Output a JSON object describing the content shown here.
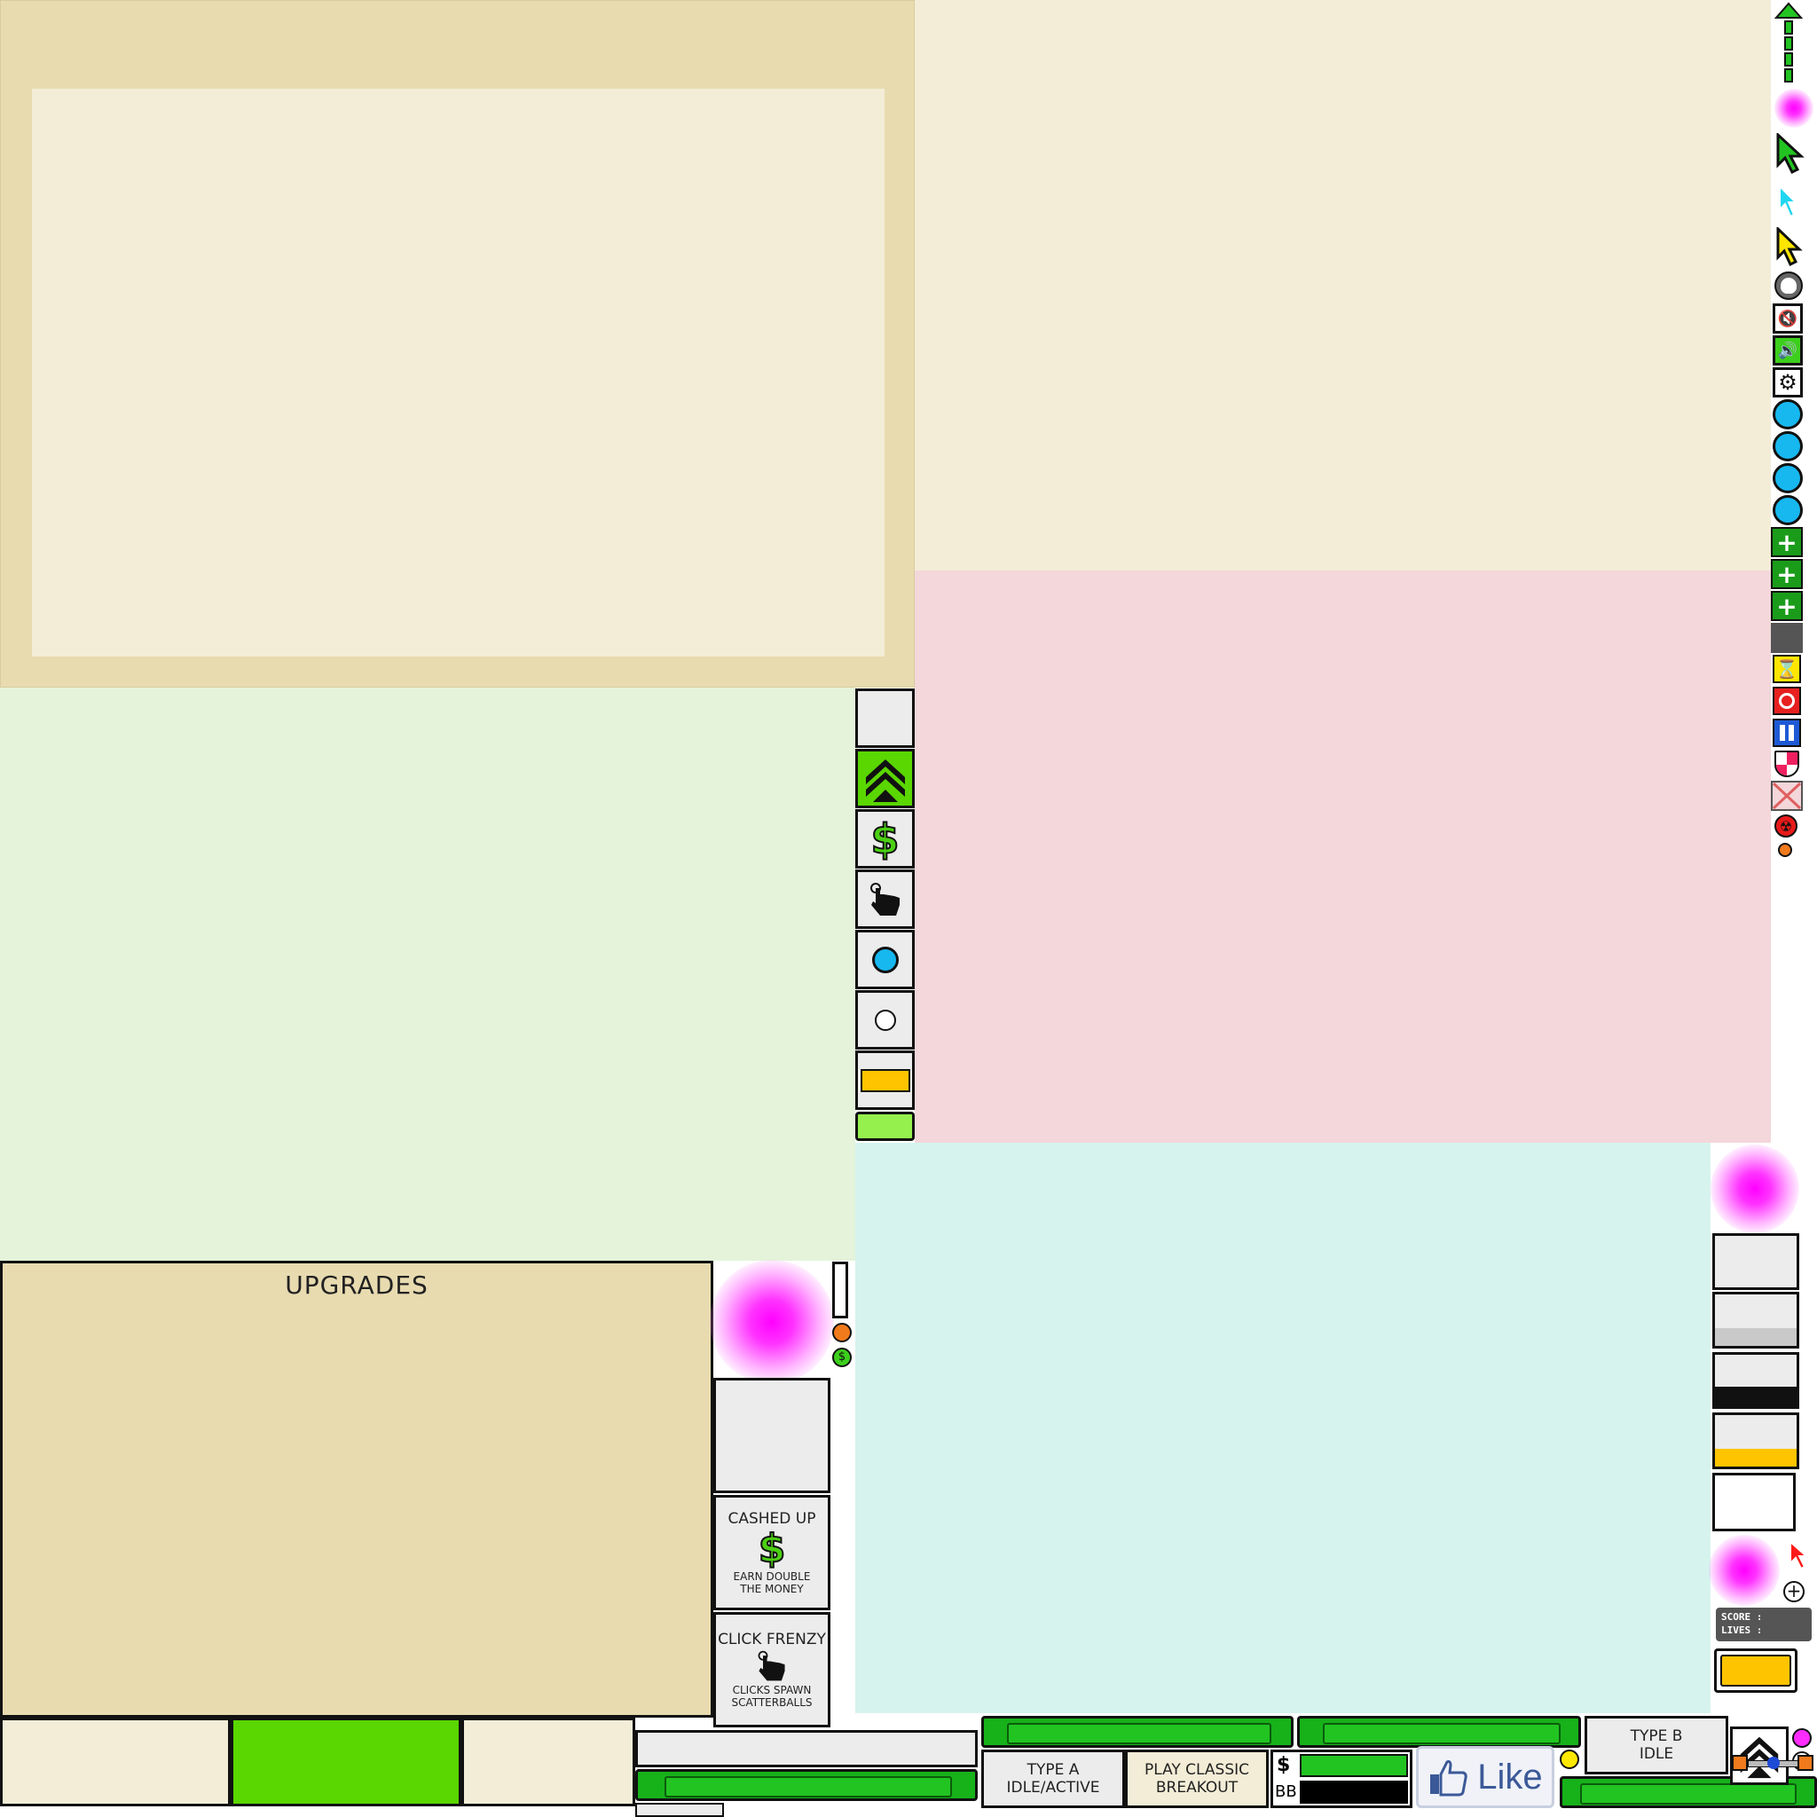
{
  "upgrades": {
    "title": "UPGRADES"
  },
  "cards": {
    "cashed_up": {
      "title": "CASHED UP",
      "desc_line1": "EARN DOUBLE",
      "desc_line2": "THE MONEY"
    },
    "click_frenzy": {
      "title": "CLICK FRENZY",
      "desc_line1": "CLICKS SPAWN",
      "desc_line2": "SCATTERBALLS"
    }
  },
  "mode_buttons": {
    "type_a": {
      "line1": "TYPE A",
      "line2": "IDLE/ACTIVE"
    },
    "classic": {
      "line1": "PLAY CLASSIC",
      "line2": "BREAKOUT"
    },
    "type_b": {
      "line1": "TYPE B",
      "line2": "IDLE"
    }
  },
  "currency": {
    "dollar": "$",
    "bb": "BB"
  },
  "like_button": {
    "label": "Like"
  },
  "stats_panel": {
    "score_label": "SCORE :",
    "lives_label": "LIVES :"
  },
  "colors": {
    "panel_cream": "#f3edd7",
    "panel_tan": "#e8dbb0",
    "panel_green": "#e4f3da",
    "panel_pink": "#f3d7da",
    "panel_teal": "#d7f3ee",
    "accent_green": "#5ad600",
    "accent_yellow": "#ffc400",
    "ball_blue": "#17b8f0"
  },
  "icons": {
    "side_tools": [
      "green-up-arrow-icon",
      "magenta-glow-icon",
      "green-cursor-icon",
      "cyan-cursor-icon",
      "yellow-cursor-icon",
      "skull-icon",
      "sound-off-icon",
      "sound-on-icon",
      "gear-icon",
      "blue-ball-icon",
      "blue-ball-icon",
      "blue-ball-icon",
      "blue-ball-icon",
      "green-plus-icon",
      "green-plus-icon",
      "green-plus-icon",
      "blank-tile-icon",
      "hourglass-icon",
      "target-icon",
      "pause-icon",
      "shield-icon",
      "close-x-icon",
      "radiation-icon",
      "small-orange-ball-icon"
    ]
  }
}
